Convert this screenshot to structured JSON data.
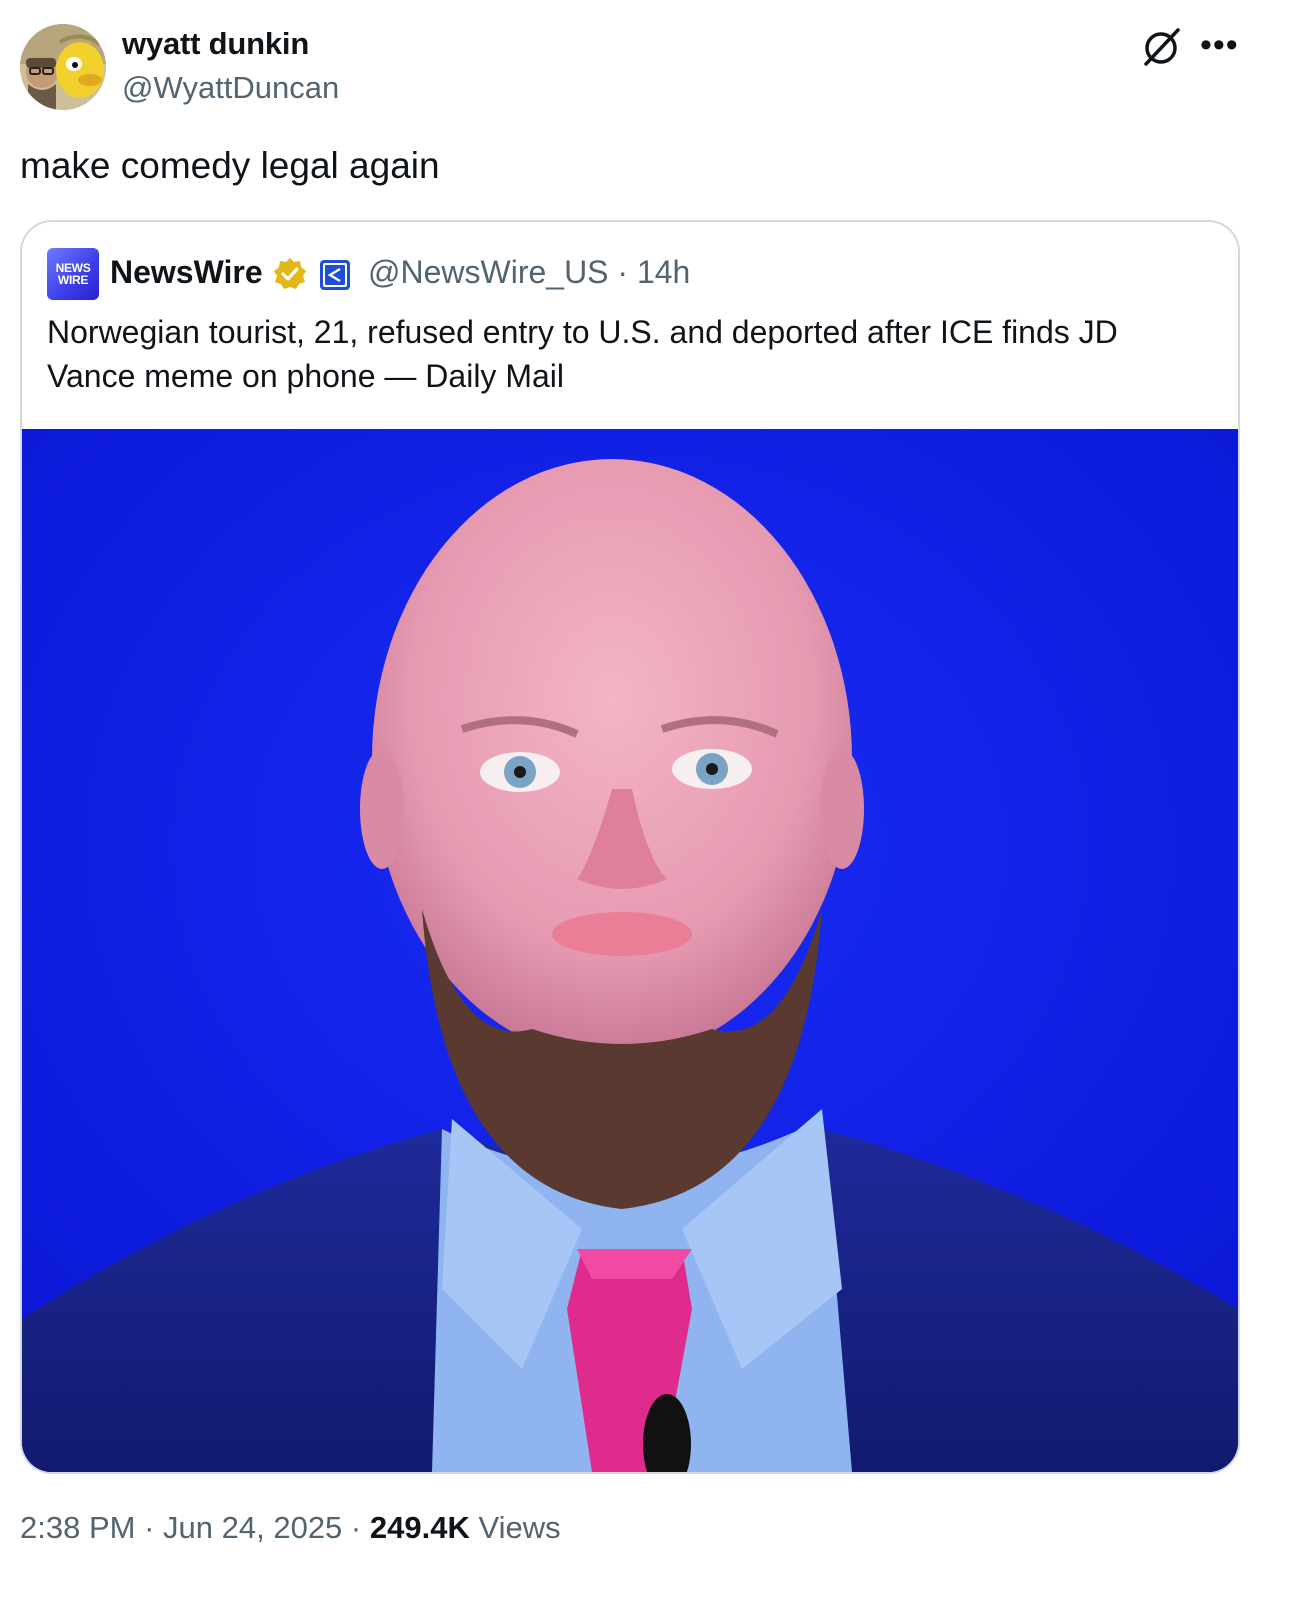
{
  "author": {
    "name": "wyatt dunkin",
    "handle": "@WyattDuncan",
    "avatar_icon": "profile-photo-with-cartoon-avatar"
  },
  "tweet": {
    "text": "make comedy legal again"
  },
  "quoted": {
    "avatar_text_line1": "NEWS",
    "avatar_text_line2": "WIRE",
    "name": "NewsWire",
    "verified_icon": "gold-verified-badge-icon",
    "affiliate_icon": "affiliate-badge-icon",
    "handle": "@NewsWire_US",
    "separator": "·",
    "time": "14h",
    "text": "Norwegian tourist, 21, refused entry to U.S. and deported after ICE finds JD Vance meme on phone — Daily Mail",
    "image_description_icon": "meme-photo-of-man-in-suit"
  },
  "footer": {
    "time": "2:38 PM",
    "sep1": "·",
    "date": "Jun 24, 2025",
    "sep2": "·",
    "views_count": "249.4K",
    "views_label": "Views"
  },
  "colors": {
    "text_primary": "#0f1419",
    "text_secondary": "#536471",
    "border": "#cfd9de",
    "image_background": "#0b1ee8",
    "verified_gold": "#e2b719"
  },
  "icons": {
    "grok": "grok-icon",
    "more": "more-options-icon"
  }
}
